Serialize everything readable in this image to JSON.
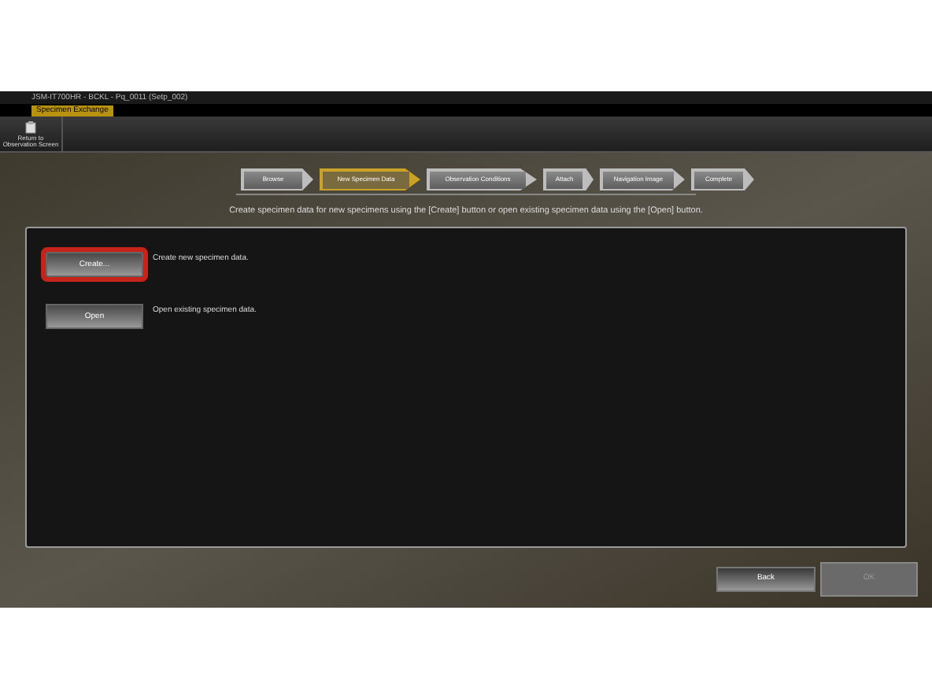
{
  "window": {
    "title": "JSM-IT700HR - BCKL - Pq_0011 (Setp_002)"
  },
  "tabs": [
    {
      "label": "Specimen Exchange",
      "selected": true
    }
  ],
  "toolbar": [
    {
      "label": "Return to Observation Screen"
    }
  ],
  "steps": [
    {
      "label": "Browse",
      "selected": false
    },
    {
      "label": "New Specimen Data",
      "selected": true
    },
    {
      "label": "Observation Conditions",
      "selected": false
    },
    {
      "label": "Attach",
      "selected": false
    },
    {
      "label": "Navigation Image",
      "selected": false
    },
    {
      "label": "Complete",
      "selected": false
    }
  ],
  "instruction": "Create specimen data for new specimens using the [Create] button or open existing specimen data using the [Open] button.",
  "actions": [
    {
      "button": "Create...",
      "description": "Create new specimen data.",
      "highlighted": true
    },
    {
      "button": "Open",
      "description": "Open existing specimen data.",
      "highlighted": false
    }
  ],
  "footer": [
    {
      "label": "Back",
      "disabled": false
    },
    {
      "label": "OK",
      "disabled": true
    }
  ]
}
